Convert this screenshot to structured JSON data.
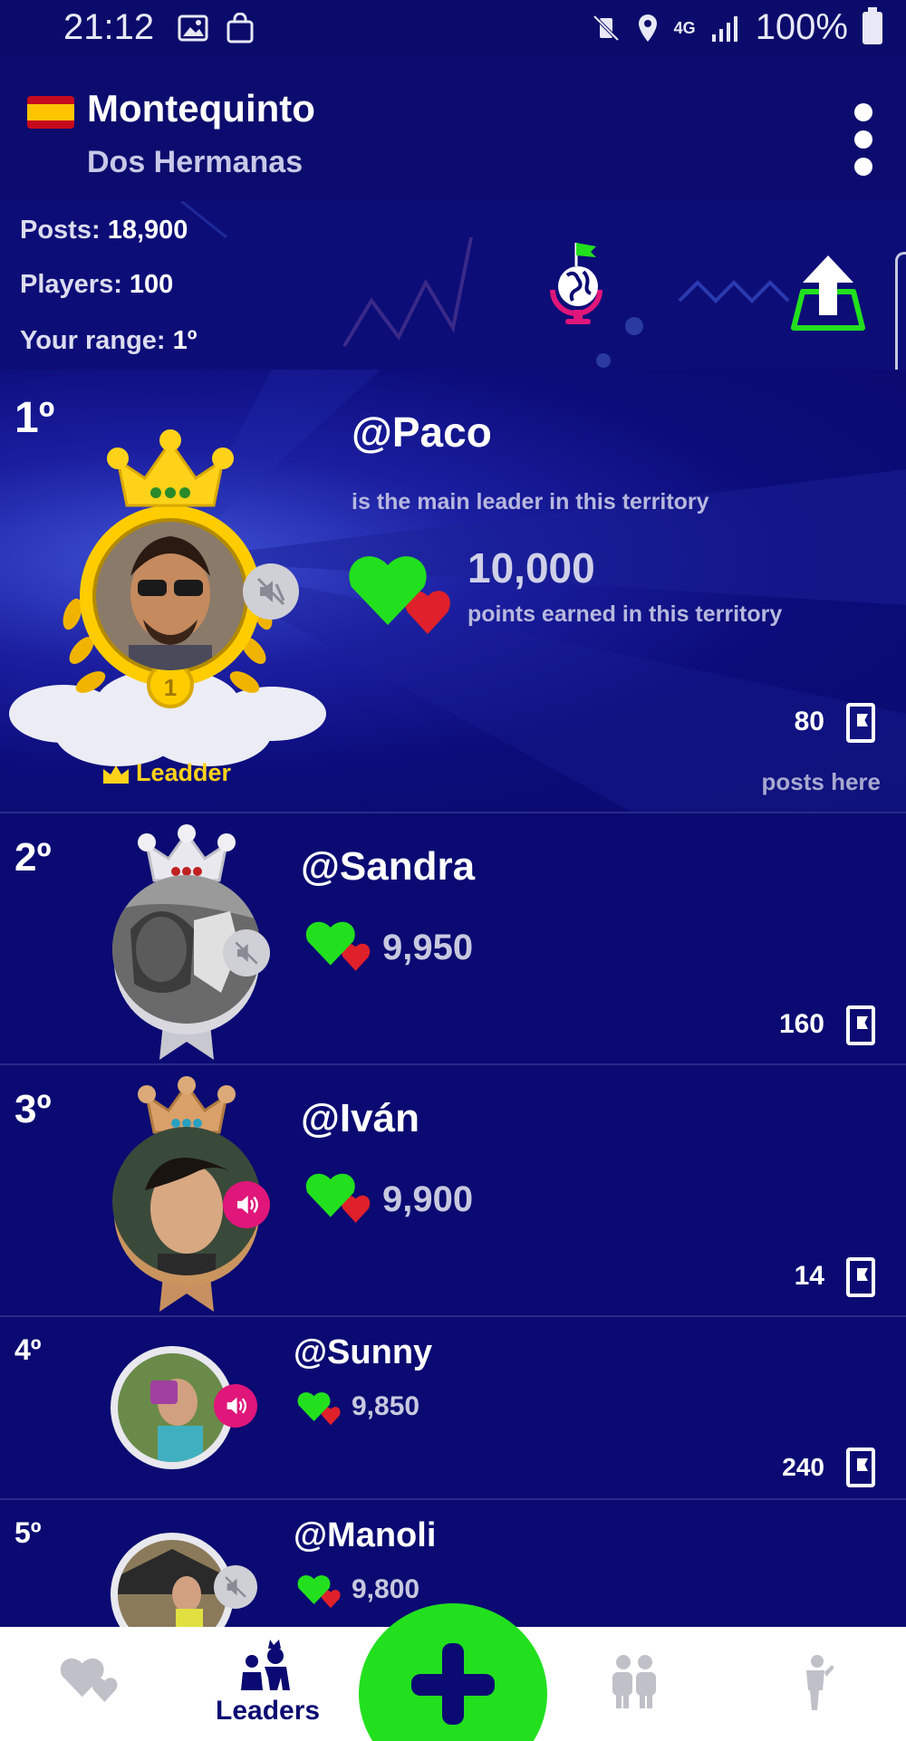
{
  "status_bar": {
    "time": "21:12",
    "battery": "100%",
    "network": "4G"
  },
  "header": {
    "title": "Montequinto",
    "subtitle": "Dos Hermanas",
    "flag": "spain-flag"
  },
  "stats": {
    "posts_label": "Posts:",
    "posts_value": "18,900",
    "players_label": "Players:",
    "players_value": "100",
    "range_label": "Your range:",
    "range_value": "1º"
  },
  "leader": {
    "rank": "1º",
    "name": "@Paco",
    "description": "is the main leader in this territory",
    "points": "10,000",
    "points_label": "points earned in this territory",
    "posts": "80",
    "posts_label": "posts here",
    "badge": "Leadder",
    "medal": "1"
  },
  "rows": [
    {
      "rank": "2º",
      "name": "@Sandra",
      "points": "9,950",
      "posts": "160",
      "sound": "muted"
    },
    {
      "rank": "3º",
      "name": "@Iván",
      "points": "9,900",
      "posts": "14",
      "sound": "on"
    },
    {
      "rank": "4º",
      "name": "@Sunny",
      "points": "9,850",
      "posts": "240",
      "sound": "on"
    },
    {
      "rank": "5º",
      "name": "@Manoli",
      "points": "9,800",
      "posts": "",
      "sound": "muted"
    }
  ],
  "nav": {
    "leaders_label": "Leaders"
  },
  "colors": {
    "background": "#0a0a72",
    "accent_green": "#22e01e",
    "heart_red": "#e0202a",
    "gold": "#ffd21a",
    "pink": "#e0167a"
  }
}
